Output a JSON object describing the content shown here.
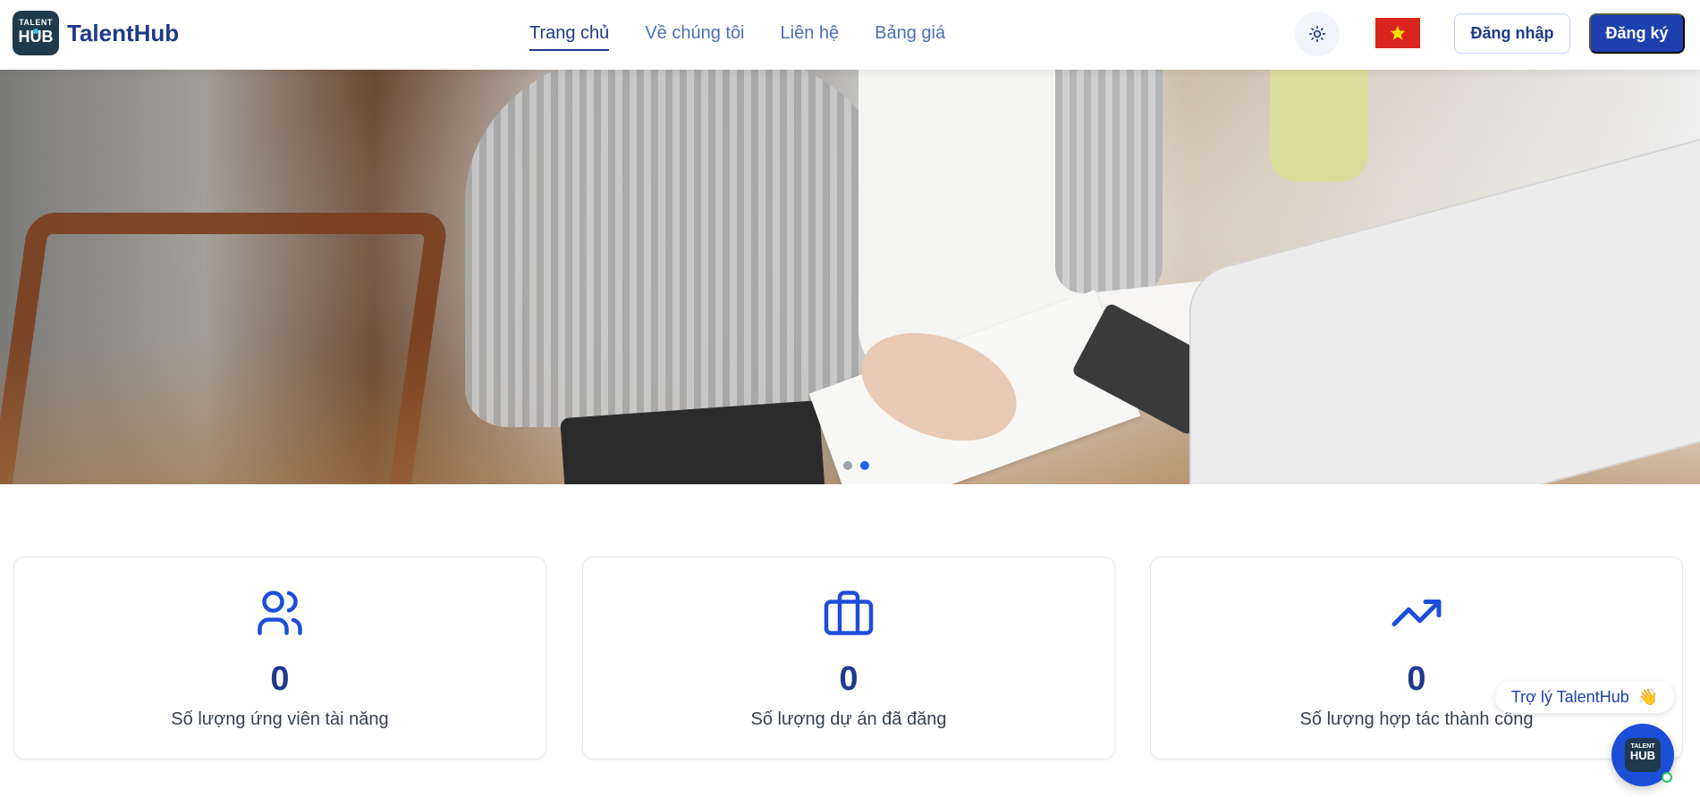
{
  "header": {
    "logo_top": "TALENT",
    "logo_bottom": "HUB",
    "brand": "TalentHub",
    "nav": [
      {
        "label": "Trang chủ",
        "active": true
      },
      {
        "label": "Về chúng tôi",
        "active": false
      },
      {
        "label": "Liên hệ",
        "active": false
      },
      {
        "label": "Bảng giá",
        "active": false
      }
    ],
    "theme_icon": "sun-icon",
    "language_flag": "vietnam-flag",
    "login_label": "Đăng nhập",
    "register_label": "Đăng ký"
  },
  "hero": {
    "slides_count": 2,
    "active_slide": 2
  },
  "stats": [
    {
      "icon": "users-icon",
      "value": "0",
      "label": "Số lượng ứng viên tài năng"
    },
    {
      "icon": "briefcase-icon",
      "value": "0",
      "label": "Số lượng dự án đã đăng"
    },
    {
      "icon": "trending-up-icon",
      "value": "0",
      "label": "Số lượng hợp tác thành công"
    }
  ],
  "assistant": {
    "bubble_text": "Trợ lý TalentHub",
    "bubble_emoji": "👋",
    "logo_top": "TALENT",
    "logo_bottom": "HUB"
  },
  "colors": {
    "primary": "#1e40af",
    "brand_text": "#1e3a8a",
    "flag_red": "#da251d",
    "flag_star": "#ffde00"
  }
}
